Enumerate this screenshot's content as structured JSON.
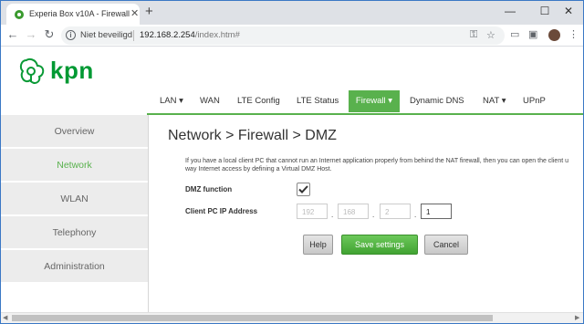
{
  "browser": {
    "tab_title": "Experia Box v10A - Firewall&nbsp;",
    "tab_close": "✕",
    "new_tab": "+",
    "window_controls": [
      "—",
      "☐",
      "✕"
    ],
    "nav_icons": [
      "back-icon",
      "forward-icon",
      "reload-icon"
    ],
    "security_label": "Niet beveiligd",
    "url_host": "192.168.2.254",
    "url_path": "/index.htm#",
    "toolbar_icons": [
      "key-icon",
      "star-icon",
      "cast-icon",
      "screenshot-icon",
      "avatar",
      "menu-icon"
    ]
  },
  "site": {
    "brand": "kpn",
    "brand_color": "#009900",
    "accent": "#59b14d"
  },
  "topnav": {
    "items": [
      {
        "label": "LAN ▾"
      },
      {
        "label": "WAN"
      },
      {
        "label": "LTE Config"
      },
      {
        "label": "LTE Status"
      },
      {
        "label": "Firewall ▾",
        "active": true
      },
      {
        "label": "Dynamic DNS"
      },
      {
        "label": "NAT ▾"
      },
      {
        "label": "UPnP"
      }
    ]
  },
  "sidebar": {
    "items": [
      {
        "label": "Overview"
      },
      {
        "label": "Network",
        "active": true
      },
      {
        "label": "WLAN"
      },
      {
        "label": "Telephony"
      },
      {
        "label": "Administration"
      }
    ]
  },
  "main": {
    "heading": "Network > Firewall > DMZ",
    "description_line1": "If you have a local client PC that cannot run an Internet application properly from behind the NAT firewall, then you can open the client u",
    "description_line2": "way Internet access by defining a Virtual DMZ Host.",
    "dmz_label": "DMZ function",
    "dmz_checked": true,
    "ip_label": "Client PC IP Address",
    "ip": [
      "192",
      "168",
      "2",
      "1"
    ],
    "buttons": {
      "help": "Help",
      "save": "Save settings",
      "cancel": "Cancel"
    }
  }
}
